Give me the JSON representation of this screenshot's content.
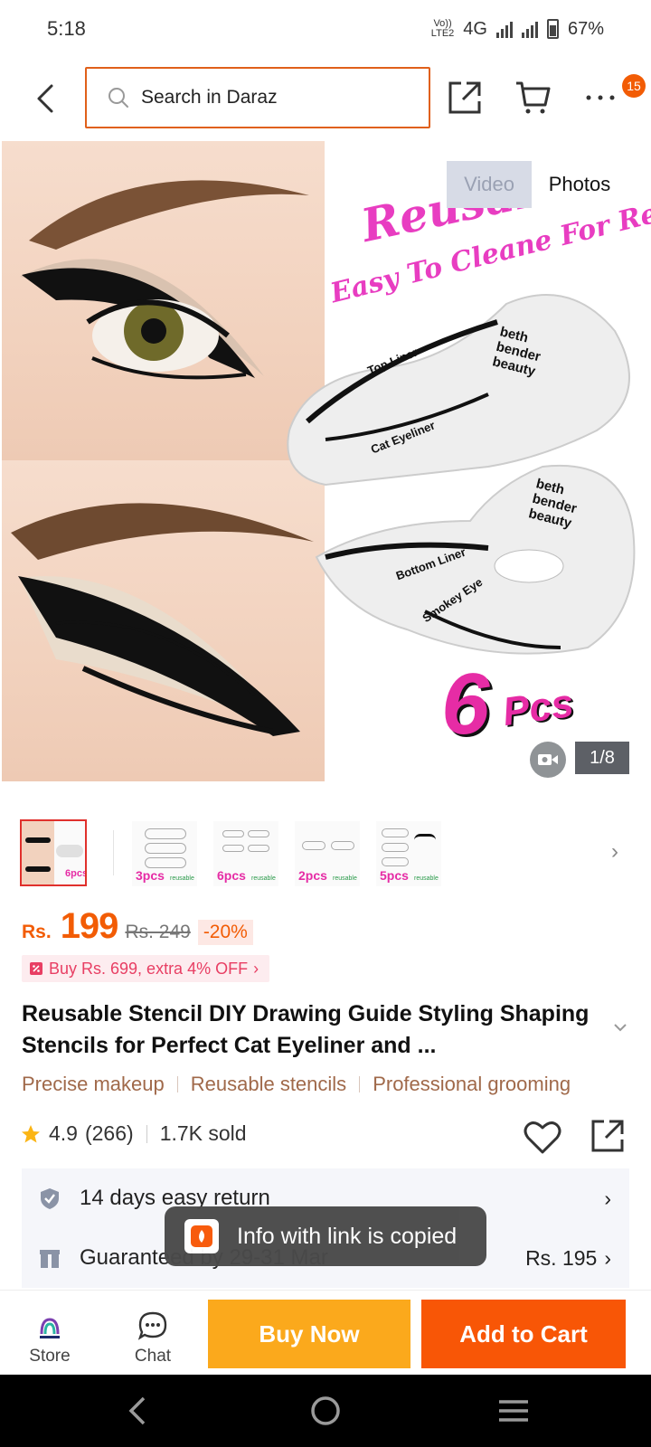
{
  "status_bar": {
    "time": "5:18",
    "volte_label_1": "Vo)) ",
    "volte_label_2": "LTE2",
    "network": "4G",
    "battery": "67%"
  },
  "header": {
    "search_placeholder": "Search in Daraz",
    "cart_badge": "15"
  },
  "gallery": {
    "tab_video": "Video",
    "tab_photos": "Photos",
    "counter": "1/8",
    "overlay_line1": "Reusable",
    "overlay_line2": "Easy To Cleane For Reuse",
    "stencil_labels": [
      "Top Liner",
      "Cat Eyeliner",
      "beth bender beauty",
      "Bottom Liner",
      "Smokey Eye",
      "beth bender beauty"
    ],
    "pcs_number": "6",
    "pcs_label": "Pcs"
  },
  "thumbnails": [
    {
      "label": "6pcs",
      "selected": true
    },
    {
      "label": "3pcs",
      "caption": "reusable",
      "selected": false
    },
    {
      "label": "6pcs",
      "caption": "reusable",
      "selected": false
    },
    {
      "label": "2pcs",
      "caption": "reusable",
      "selected": false
    },
    {
      "label": "5pcs",
      "caption": "reusable",
      "selected": false
    }
  ],
  "price": {
    "currency": "Rs.",
    "current": "199",
    "original": "Rs. 249",
    "discount": "-20%",
    "promo": "Buy Rs. 699, extra 4% OFF"
  },
  "product": {
    "title": "Reusable Stencil DIY Drawing Guide Styling Shaping Stencils for Perfect Cat Eyeliner and ..."
  },
  "tags": [
    "Precise makeup",
    "Reusable stencils",
    "Professional grooming"
  ],
  "rating": {
    "score": "4.9",
    "count": "(266)",
    "sold": "1.7K sold"
  },
  "services": {
    "return_text": "14 days easy return",
    "delivery_text": "Guaranteed by 29-31 Mar",
    "delivery_price": "Rs. 195"
  },
  "toast": {
    "message": "Info with link is copied"
  },
  "action_bar": {
    "store_label": "Store",
    "chat_label": "Chat",
    "buy_now": "Buy Now",
    "add_to_cart": "Add to Cart"
  },
  "colors": {
    "brand_orange": "#f85606",
    "buy_now_yellow": "#fba91c",
    "price_orange": "#f25c05",
    "promo_pink": "#e83e63",
    "tag_brown": "#a0694a"
  }
}
